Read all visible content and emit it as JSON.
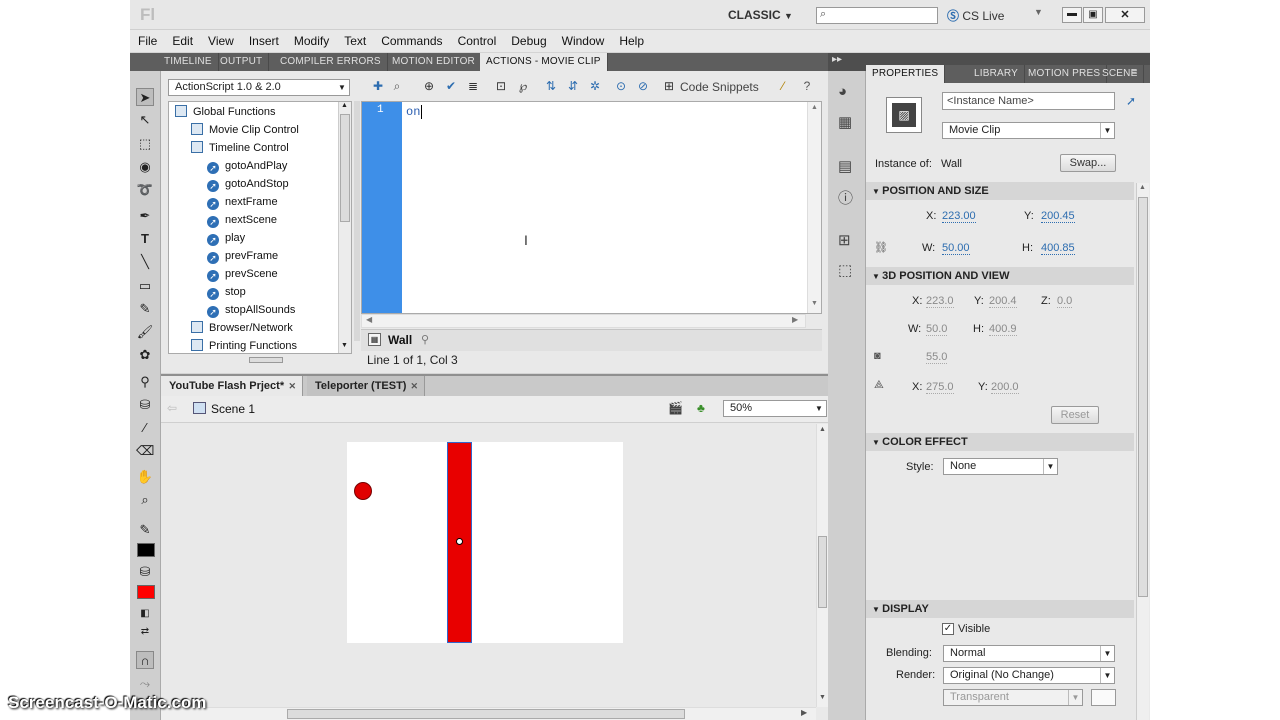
{
  "app": {
    "logo": "Fl",
    "workspace": "CLASSIC",
    "search_placeholder": "",
    "cs_live": "CS Live"
  },
  "menu": [
    "File",
    "Edit",
    "View",
    "Insert",
    "Modify",
    "Text",
    "Commands",
    "Control",
    "Debug",
    "Window",
    "Help"
  ],
  "top_tabs": [
    "TIMELINE",
    "OUTPUT",
    "COMPILER ERRORS",
    "MOTION EDITOR",
    "ACTIONS - MOVIE CLIP"
  ],
  "actions": {
    "language": "ActionScript 1.0 & 2.0",
    "code_snippets": "Code Snippets",
    "tree": [
      {
        "label": "Global Functions",
        "kind": "book",
        "level": 0
      },
      {
        "label": "Movie Clip Control",
        "kind": "book",
        "level": 1
      },
      {
        "label": "Timeline Control",
        "kind": "book",
        "level": 1
      },
      {
        "label": "gotoAndPlay",
        "kind": "fn",
        "level": 2
      },
      {
        "label": "gotoAndStop",
        "kind": "fn",
        "level": 2
      },
      {
        "label": "nextFrame",
        "kind": "fn",
        "level": 2
      },
      {
        "label": "nextScene",
        "kind": "fn",
        "level": 2
      },
      {
        "label": "play",
        "kind": "fn",
        "level": 2
      },
      {
        "label": "prevFrame",
        "kind": "fn",
        "level": 2
      },
      {
        "label": "prevScene",
        "kind": "fn",
        "level": 2
      },
      {
        "label": "stop",
        "kind": "fn",
        "level": 2
      },
      {
        "label": "stopAllSounds",
        "kind": "fn",
        "level": 2
      },
      {
        "label": "Browser/Network",
        "kind": "book",
        "level": 1
      },
      {
        "label": "Printing Functions",
        "kind": "book",
        "level": 1
      }
    ],
    "line_number": "1",
    "code": "on",
    "target_name": "Wall",
    "status": "Line 1 of 1, Col 3"
  },
  "doc_tabs": [
    "YouTube Flash Prject*",
    "Teleporter (TEST)"
  ],
  "stage": {
    "scene": "Scene 1",
    "zoom": "50%"
  },
  "props": {
    "tabs": [
      "PROPERTIES",
      "LIBRARY",
      "MOTION PRES",
      "SCENE"
    ],
    "instance_placeholder": "<Instance Name>",
    "type": "Movie Clip",
    "instance_of_label": "Instance of:",
    "instance_of": "Wall",
    "swap": "Swap...",
    "pos_size_title": "POSITION AND SIZE",
    "x_label": "X:",
    "x": "223.00",
    "y_label": "Y:",
    "y": "200.45",
    "w_label": "W:",
    "w": "50.00",
    "h_label": "H:",
    "h": "400.85",
    "pos3d_title": "3D POSITION AND VIEW",
    "x3d": "223.0",
    "y3d": "200.4",
    "z_label": "Z:",
    "z3d": "0.0",
    "w3d": "50.0",
    "h3d": "400.9",
    "persp": "55.0",
    "vx": "275.0",
    "vy": "200.0",
    "reset": "Reset",
    "color_title": "COLOR EFFECT",
    "style_label": "Style:",
    "style": "None",
    "display_title": "DISPLAY",
    "visible": "Visible",
    "blending_label": "Blending:",
    "blending": "Normal",
    "render_label": "Render:",
    "render": "Original (No Change)",
    "transparent": "Transparent"
  },
  "colors": {
    "stroke": "#000000",
    "fill": "#ff0000",
    "gutter": "#3e8fe8"
  },
  "watermark": "Screencast-O-Matic.com"
}
